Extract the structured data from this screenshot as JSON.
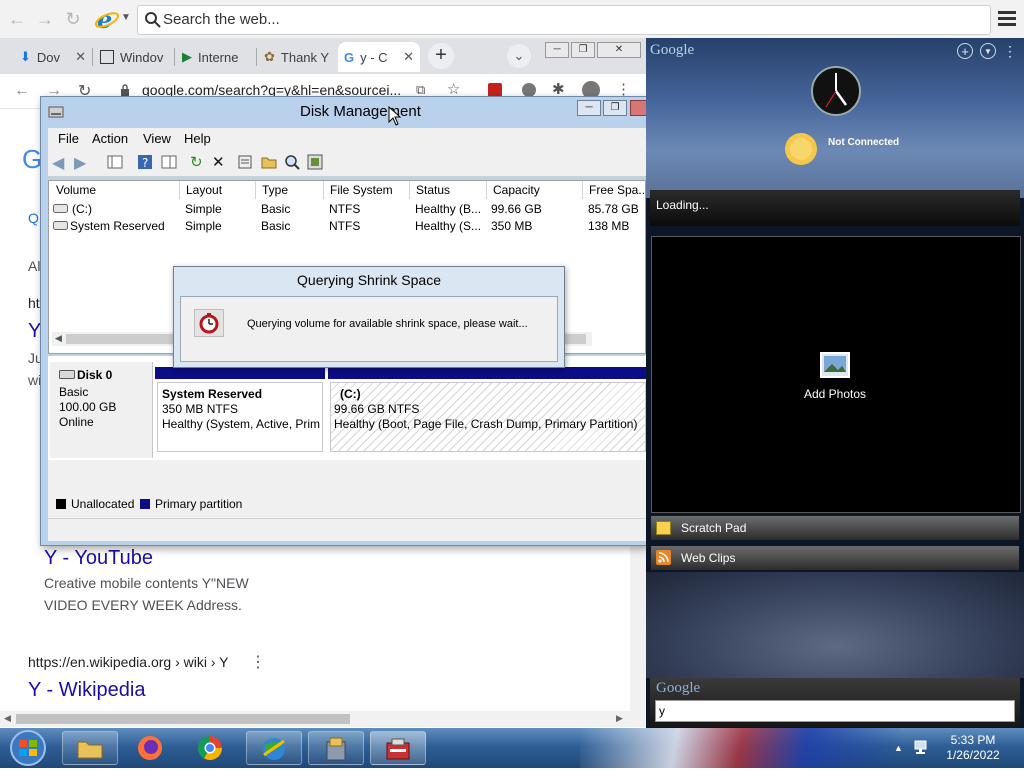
{
  "ie_bar": {
    "search_placeholder": "Search the web..."
  },
  "chrome": {
    "tabs": [
      {
        "label": "Dov"
      },
      {
        "label": "Windov"
      },
      {
        "label": "Interne"
      },
      {
        "label": "Thank Y"
      },
      {
        "label": "y - C"
      }
    ],
    "url": "google.com/search?q=y&hl=en&sourcei...",
    "results": {
      "snippet_letters": [
        "G",
        "Q",
        "Al",
        "ht",
        "Y",
        "Ju",
        "wi"
      ],
      "youtube_title": "Y - YouTube",
      "youtube_snippet_1": "Creative mobile contents Y\"NEW",
      "youtube_snippet_2": "VIDEO EVERY WEEK Address.",
      "wiki_cite": "https://en.wikipedia.org › wiki › Y",
      "wiki_title": "Y - Wikipedia"
    }
  },
  "disk_mgmt": {
    "title": "Disk Management",
    "menu": [
      "File",
      "Action",
      "View",
      "Help"
    ],
    "columns": [
      "Volume",
      "Layout",
      "Type",
      "File System",
      "Status",
      "Capacity",
      "Free Spa..."
    ],
    "rows": [
      {
        "volume": "(C:)",
        "layout": "Simple",
        "type": "Basic",
        "fs": "NTFS",
        "status": "Healthy (B...",
        "capacity": "99.66 GB",
        "free": "85.78 GB"
      },
      {
        "volume": "System Reserved",
        "layout": "Simple",
        "type": "Basic",
        "fs": "NTFS",
        "status": "Healthy (S...",
        "capacity": "350 MB",
        "free": "138 MB"
      }
    ],
    "disk": {
      "name": "Disk 0",
      "type": "Basic",
      "size": "100.00 GB",
      "state": "Online"
    },
    "partitions": [
      {
        "name": "System Reserved",
        "size": "350 MB NTFS",
        "status": "Healthy (System, Active, Prim"
      },
      {
        "name": "(C:)",
        "size": "99.66 GB NTFS",
        "status": "Healthy (Boot, Page File, Crash Dump, Primary Partition)"
      }
    ],
    "legend": [
      {
        "label": "Unallocated",
        "color": "#000000"
      },
      {
        "label": "Primary partition",
        "color": "#0c0c87"
      }
    ],
    "dialog": {
      "title": "Querying Shrink Space",
      "message": "Querying volume for available shrink space, please wait..."
    }
  },
  "sidebar": {
    "brand": "Google",
    "weather_status": "Not Connected",
    "loading": "Loading...",
    "add_photos": "Add Photos",
    "gadgets": [
      {
        "label": "Scratch Pad",
        "icon": "notepad-icon"
      },
      {
        "label": "Web Clips",
        "icon": "rss-icon"
      }
    ],
    "search_brand": "Google",
    "search_value": "y"
  },
  "taskbar": {
    "time": "5:33 PM",
    "date": "1/26/2022",
    "apps": [
      "file-explorer-icon",
      "firefox-icon",
      "chrome-icon",
      "network-globe-icon",
      "installer-icon",
      "disk-management-icon"
    ]
  },
  "colors": {
    "accent_blue": "#1a0dab",
    "primary_partition": "#0c0c87",
    "taskbar": "#2f5f96"
  }
}
